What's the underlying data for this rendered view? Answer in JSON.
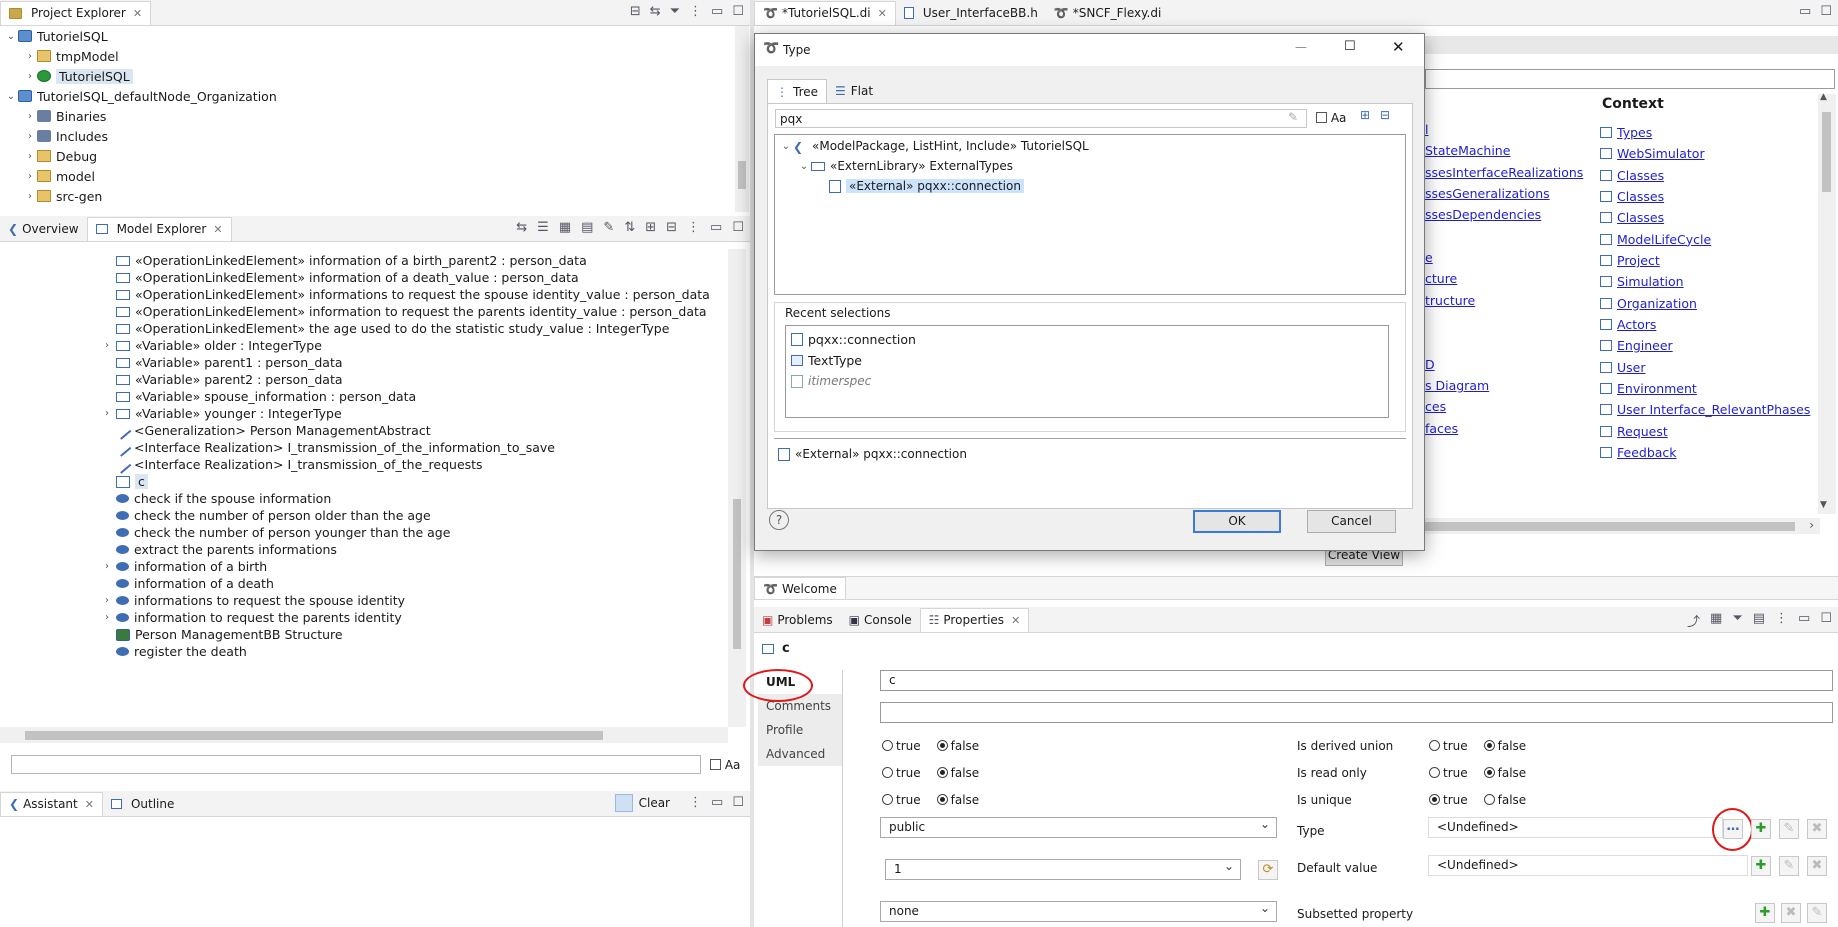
{
  "project_explorer": {
    "tab_label": "Project Explorer",
    "tree": [
      {
        "label": "TutorielSQL",
        "level": 0,
        "icon": "project-icon",
        "expanded": true
      },
      {
        "label": "tmpModel",
        "level": 1,
        "icon": "folder-icon",
        "expanded": false
      },
      {
        "label": "TutorielSQL",
        "level": 1,
        "icon": "papyrus-model-icon",
        "expanded": false,
        "selected": true
      },
      {
        "label": "TutorielSQL_defaultNode_Organization",
        "level": 0,
        "icon": "project-icon",
        "expanded": true
      },
      {
        "label": "Binaries",
        "level": 1,
        "icon": "binaries-icon",
        "expanded": false
      },
      {
        "label": "Includes",
        "level": 1,
        "icon": "includes-icon",
        "expanded": false
      },
      {
        "label": "Debug",
        "level": 1,
        "icon": "folder-icon",
        "expanded": false
      },
      {
        "label": "model",
        "level": 1,
        "icon": "folder-icon",
        "expanded": false
      },
      {
        "label": "src-gen",
        "level": 1,
        "icon": "folder-icon",
        "expanded": false
      }
    ]
  },
  "model_explorer": {
    "tabs": [
      "Overview",
      "Model Explorer"
    ],
    "items": [
      {
        "label": "«OperationLinkedElement» information of a birth_parent2 : person_data",
        "icon": "class-icon",
        "arrow": false
      },
      {
        "label": "«OperationLinkedElement» information of a death_value : person_data",
        "icon": "class-icon",
        "arrow": false
      },
      {
        "label": "«OperationLinkedElement» informations to request the spouse identity_value : person_data",
        "icon": "class-icon",
        "arrow": false
      },
      {
        "label": "«OperationLinkedElement» information to request the parents identity_value : person_data",
        "icon": "class-icon",
        "arrow": false
      },
      {
        "label": "«OperationLinkedElement» the age used to do the statistic study_value : IntegerType",
        "icon": "class-icon",
        "arrow": false
      },
      {
        "label": "«Variable» older : IntegerType",
        "icon": "class-icon",
        "arrow": true
      },
      {
        "label": "«Variable» parent1 : person_data",
        "icon": "class-icon",
        "arrow": false
      },
      {
        "label": "«Variable» parent2 : person_data",
        "icon": "class-icon",
        "arrow": false
      },
      {
        "label": "«Variable» spouse_information : person_data",
        "icon": "class-icon",
        "arrow": false
      },
      {
        "label": "«Variable» younger : IntegerType",
        "icon": "class-icon",
        "arrow": true
      },
      {
        "label": "<Generalization> Person ManagementAbstract",
        "icon": "generalization-icon",
        "arrow": false
      },
      {
        "label": "<Interface Realization> I_transmission_of_the_information_to_save",
        "icon": "realization-icon",
        "arrow": false
      },
      {
        "label": "<Interface Realization> I_transmission_of_the_requests",
        "icon": "realization-icon",
        "arrow": false
      },
      {
        "label": "c",
        "icon": "property-icon",
        "arrow": false,
        "selected": true
      },
      {
        "label": "check if the spouse information",
        "icon": "operation-icon",
        "arrow": false
      },
      {
        "label": "check the number of person older than the age",
        "icon": "operation-icon",
        "arrow": false
      },
      {
        "label": "check the number of person younger than the age",
        "icon": "operation-icon",
        "arrow": false
      },
      {
        "label": "extract the parents informations",
        "icon": "operation-icon",
        "arrow": false
      },
      {
        "label": "information of a birth",
        "icon": "operation-icon",
        "arrow": true
      },
      {
        "label": "information of a death",
        "icon": "operation-icon",
        "arrow": false
      },
      {
        "label": "informations to request the spouse identity",
        "icon": "operation-icon",
        "arrow": true
      },
      {
        "label": "information to request the parents identity",
        "icon": "operation-icon",
        "arrow": true
      },
      {
        "label": "Person ManagementBB Structure",
        "icon": "diagram-icon",
        "arrow": false
      },
      {
        "label": "register the death",
        "icon": "operation-icon",
        "arrow": false
      }
    ],
    "filter_aa": "Aa"
  },
  "assistant": {
    "tabs": [
      "Assistant",
      "Outline"
    ],
    "clear_label": "Clear"
  },
  "editor": {
    "tabs": [
      "*TutorielSQL.di",
      "User_InterfaceBB.h",
      "*SNCF_Flexy.di"
    ],
    "context_header": "Context",
    "context_links": [
      "Types",
      "WebSimulator",
      "Classes",
      "Classes",
      "Classes",
      "ModelLifeCycle",
      "Project",
      "Simulation",
      "Organization",
      "Actors",
      "Engineer",
      "User",
      "Environment",
      "User Interface_RelevantPhases",
      "Request",
      "Feedback"
    ],
    "partial_links": [
      "l",
      "StateMachine",
      "ssesInterfaceRealizations",
      "ssesGeneralizations",
      "ssesDependencies",
      "",
      "e",
      "cture",
      "tructure",
      "",
      "",
      "D",
      "s Diagram",
      "ces",
      "faces"
    ],
    "create_view": "Create View",
    "welcome_tab": "Welcome"
  },
  "dialog": {
    "title": "Type",
    "tabs": [
      "Tree",
      "Flat"
    ],
    "search_value": "pqx",
    "aa_label": "Aa",
    "tree": [
      {
        "label": "«ModelPackage, ListHint, Include» TutorielSQL",
        "level": 0
      },
      {
        "label": "«ExternLibrary» ExternalTypes",
        "level": 1
      },
      {
        "label": "«External» pqxx::connection",
        "level": 2,
        "selected": true
      }
    ],
    "recent_label": "Recent selections",
    "recent": [
      "pqxx::connection",
      "TextType",
      "itimerspec"
    ],
    "selection_status": "«External» pqxx::connection",
    "ok": "OK",
    "cancel": "Cancel"
  },
  "properties": {
    "tabs": [
      "Problems",
      "Console",
      "Properties"
    ],
    "element_name": "c",
    "side_tabs": [
      "UML",
      "Comments",
      "Profile",
      "Advanced"
    ],
    "name_value": "c",
    "label_value": "",
    "left_radios": [
      {
        "true": "true",
        "false": "false",
        "selected": "false"
      },
      {
        "true": "true",
        "false": "false",
        "selected": "false"
      },
      {
        "true": "true",
        "false": "false",
        "selected": "false"
      }
    ],
    "right_radios": [
      {
        "label": "Is derived union",
        "true": "true",
        "false": "false",
        "selected": "false"
      },
      {
        "label": "Is read only",
        "true": "true",
        "false": "false",
        "selected": "false"
      },
      {
        "label": "Is unique",
        "true": "true",
        "false": "false",
        "selected": "true"
      }
    ],
    "visibility": "public",
    "multiplicity": "1",
    "aggregation": "none",
    "type_label": "Type",
    "type_value": "<Undefined>",
    "default_label": "Default value",
    "default_value": "<Undefined>",
    "subsetted_label": "Subsetted property"
  }
}
